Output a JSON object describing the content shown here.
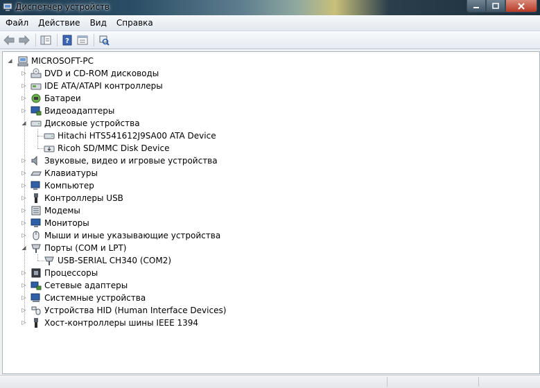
{
  "window": {
    "title": "Диспетчер устройств"
  },
  "menu": [
    "Файл",
    "Действие",
    "Вид",
    "Справка"
  ],
  "toolbar": {
    "buttons": [
      "back-icon",
      "forward-icon",
      "properties-pane-icon",
      "help-icon",
      "console-tree-icon",
      "scan-hardware-icon"
    ]
  },
  "tree": {
    "root": "MICROSOFT-PC",
    "items": [
      {
        "label": "DVD и CD-ROM дисководы",
        "icon": "dvd-drive-icon",
        "expanded": false
      },
      {
        "label": "IDE ATA/ATAPI контроллеры",
        "icon": "ide-controller-icon",
        "expanded": false
      },
      {
        "label": "Батареи",
        "icon": "battery-icon",
        "expanded": false
      },
      {
        "label": "Видеоадаптеры",
        "icon": "display-adapter-icon",
        "expanded": false
      },
      {
        "label": "Дисковые устройства",
        "icon": "disk-drive-icon",
        "expanded": true,
        "children": [
          {
            "label": "Hitachi HTS541612J9SA00 ATA Device",
            "icon": "disk-drive-icon"
          },
          {
            "label": "Ricoh SD/MMC Disk Device",
            "icon": "removable-disk-icon"
          }
        ]
      },
      {
        "label": "Звуковые, видео и игровые устройства",
        "icon": "speaker-icon",
        "expanded": false
      },
      {
        "label": "Клавиатуры",
        "icon": "keyboard-icon",
        "expanded": false
      },
      {
        "label": "Компьютер",
        "icon": "computer-icon",
        "expanded": false
      },
      {
        "label": "Контроллеры USB",
        "icon": "usb-icon",
        "expanded": false
      },
      {
        "label": "Модемы",
        "icon": "modem-icon",
        "expanded": false
      },
      {
        "label": "Мониторы",
        "icon": "monitor-icon",
        "expanded": false
      },
      {
        "label": "Мыши и иные указывающие устройства",
        "icon": "mouse-icon",
        "expanded": false
      },
      {
        "label": "Порты (COM и LPT)",
        "icon": "port-icon",
        "expanded": true,
        "children": [
          {
            "label": "USB-SERIAL CH340 (COM2)",
            "icon": "port-icon"
          }
        ]
      },
      {
        "label": "Процессоры",
        "icon": "processor-icon",
        "expanded": false
      },
      {
        "label": "Сетевые адаптеры",
        "icon": "network-adapter-icon",
        "expanded": false
      },
      {
        "label": "Системные устройства",
        "icon": "system-device-icon",
        "expanded": false
      },
      {
        "label": "Устройства HID (Human Interface Devices)",
        "icon": "hid-icon",
        "expanded": false
      },
      {
        "label": "Хост-контроллеры шины IEEE 1394",
        "icon": "ieee1394-icon",
        "expanded": false
      }
    ]
  }
}
